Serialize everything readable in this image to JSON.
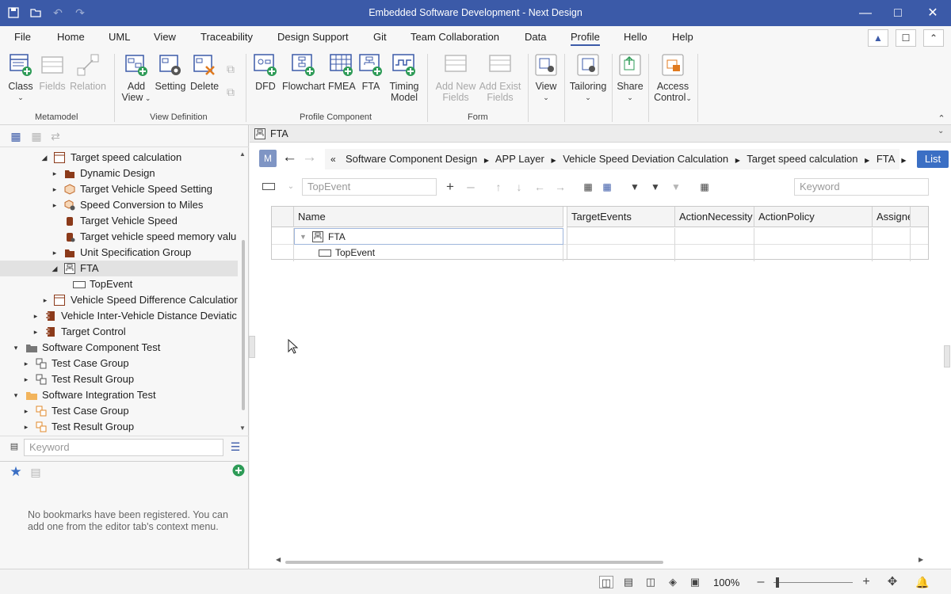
{
  "window": {
    "title": "Embedded Software Development - Next Design"
  },
  "menu": {
    "items": [
      "File",
      "Home",
      "UML",
      "View",
      "Traceability",
      "Design Support",
      "Git",
      "Team Collaboration",
      "Data",
      "Profile",
      "Hello",
      "Help"
    ],
    "active": "Profile"
  },
  "ribbon": {
    "buttons": {
      "class": "Class",
      "fields": "Fields",
      "relation": "Relation",
      "add_view_1": "Add",
      "add_view_2": "View",
      "setting": "Setting",
      "delete": "Delete",
      "dfd": "DFD",
      "flowchart": "Flowchart",
      "fmea": "FMEA",
      "fta": "FTA",
      "timing_1": "Timing",
      "timing_2": "Model",
      "add_new_1": "Add New",
      "add_new_2": "Fields",
      "add_exist_1": "Add Exist",
      "add_exist_2": "Fields",
      "view": "View",
      "tailoring": "Tailoring",
      "share": "Share",
      "access_1": "Access",
      "access_2": "Control"
    },
    "groups": {
      "metamodel": "Metamodel",
      "view_definition": "View Definition",
      "profile_component": "Profile Component",
      "form": "Form"
    }
  },
  "tree": {
    "items": [
      {
        "label": "Target speed calculation",
        "icon": "frame-icon",
        "expanded": true
      },
      {
        "label": "Dynamic Design",
        "icon": "folder-icon",
        "expanded": false
      },
      {
        "label": "Target Vehicle Speed Setting",
        "icon": "cube-icon",
        "expanded": false
      },
      {
        "label": "Speed Conversion to Miles",
        "icon": "gear-cube-icon",
        "expanded": false
      },
      {
        "label": "Target Vehicle Speed",
        "icon": "cylinder-icon"
      },
      {
        "label": "Target vehicle speed memory valu",
        "icon": "cylinder-icon"
      },
      {
        "label": "Unit Specification Group",
        "icon": "folder-icon",
        "expanded": false
      },
      {
        "label": "FTA",
        "icon": "fta-icon",
        "expanded": true
      },
      {
        "label": "TopEvent",
        "icon": "rect-icon"
      },
      {
        "label": "Vehicle Speed Difference Calculatior",
        "icon": "frame-icon",
        "expanded": false
      },
      {
        "label": "Vehicle Inter-Vehicle Distance Deviatic",
        "icon": "component-icon",
        "expanded": false
      },
      {
        "label": "Target Control",
        "icon": "component-icon",
        "expanded": false
      },
      {
        "label": "Software Component Test",
        "icon": "gray-folder-icon",
        "expanded": true
      },
      {
        "label": "Test Case Group",
        "icon": "group-icon",
        "expanded": false
      },
      {
        "label": "Test Result Group",
        "icon": "group-icon",
        "expanded": false
      },
      {
        "label": "Software Integration Test",
        "icon": "orange-folder-icon",
        "expanded": true
      },
      {
        "label": "Test Case Group",
        "icon": "orange-group-icon",
        "expanded": false
      },
      {
        "label": "Test Result Group",
        "icon": "orange-group-icon",
        "expanded": false
      }
    ],
    "search_placeholder": "Keyword"
  },
  "bookmarks": {
    "empty_message": "No bookmarks have been registered. You can add one from the editor tab's context menu."
  },
  "editor": {
    "tab_label": "FTA",
    "model_badge": "M",
    "breadcrumb": [
      "Software Component Design",
      "APP Layer",
      "Vehicle Speed Deviation Calculation",
      "Target speed calculation",
      "FTA"
    ],
    "list_button": "List",
    "type_field_placeholder": "TopEvent",
    "keyword_placeholder": "Keyword",
    "grid": {
      "columns": [
        "Name",
        "TargetEvents",
        "ActionNecessity",
        "ActionPolicy",
        "Assigne"
      ],
      "rows": [
        {
          "name": "FTA"
        },
        {
          "name": "TopEvent"
        }
      ]
    }
  },
  "status": {
    "zoom": "100%"
  },
  "colors": {
    "accent": "#3b5aa8",
    "list_button": "#3b6fc4",
    "add_green": "#2e9b57",
    "brown_folder": "#8b3a1a",
    "orange": "#e08a2b"
  }
}
